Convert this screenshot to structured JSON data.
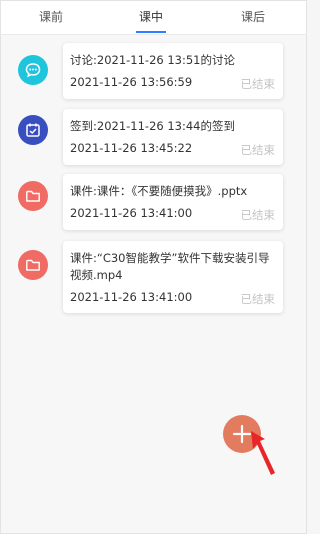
{
  "tabs": [
    {
      "label": "课前"
    },
    {
      "label": "课中"
    },
    {
      "label": "课后"
    }
  ],
  "active_tab": "课中",
  "activities": [
    {
      "icon": "chat-bubble-icon",
      "icon_color": "#1ec5dd",
      "title": "讨论:2021-11-26 13:51的讨论",
      "time": "2021-11-26 13:56:59",
      "status": "已结束"
    },
    {
      "icon": "checkin-calendar-icon",
      "icon_color": "#3a4fbf",
      "title": "签到:2021-11-26 13:44的签到",
      "time": "2021-11-26 13:45:22",
      "status": "已结束"
    },
    {
      "icon": "folder-icon",
      "icon_color": "#ef6b64",
      "title": "课件:课件：《不要随便摸我》.pptx",
      "time": "2021-11-26 13:41:00",
      "status": "已结束"
    },
    {
      "icon": "folder-icon",
      "icon_color": "#ef6b64",
      "title": "课件:“C30智能教学”软件下载安装引导视频.mp4",
      "time": "2021-11-26 13:41:00",
      "status": "已结束"
    }
  ],
  "fab": {
    "icon": "plus-icon",
    "color": "#e37b5e"
  },
  "pointer": {
    "icon": "red-arrow-icon",
    "color": "#e8262a"
  }
}
